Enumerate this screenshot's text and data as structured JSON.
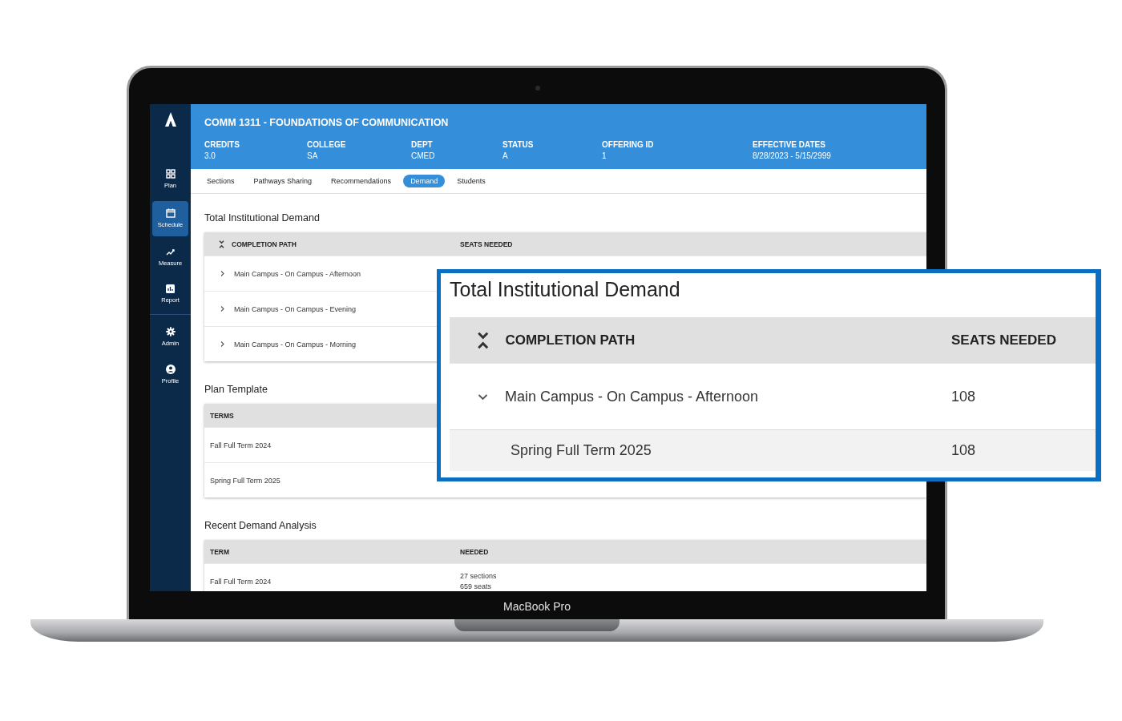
{
  "laptop": {
    "label": "MacBook Pro"
  },
  "sidebar": {
    "items": [
      {
        "label": "Plan",
        "selected": false
      },
      {
        "label": "Schedule",
        "selected": true
      },
      {
        "label": "Measure",
        "selected": false
      },
      {
        "label": "Report",
        "selected": false
      },
      {
        "label": "Admin",
        "selected": false
      },
      {
        "label": "Profile",
        "selected": false
      }
    ]
  },
  "course": {
    "title": "COMM 1311 - FOUNDATIONS OF COMMUNICATION",
    "fields": [
      {
        "label": "CREDITS",
        "value": "3.0"
      },
      {
        "label": "COLLEGE",
        "value": "SA"
      },
      {
        "label": "DEPT",
        "value": "CMED"
      },
      {
        "label": "STATUS",
        "value": "A"
      },
      {
        "label": "OFFERING ID",
        "value": "1"
      },
      {
        "label": "EFFECTIVE DATES",
        "value": "8/28/2023 - 5/15/2999"
      }
    ]
  },
  "tabs": [
    {
      "label": "Sections",
      "selected": false
    },
    {
      "label": "Pathways Sharing",
      "selected": false
    },
    {
      "label": "Recommendations",
      "selected": false
    },
    {
      "label": "Demand",
      "selected": true
    },
    {
      "label": "Students",
      "selected": false
    }
  ],
  "institutional_demand": {
    "title": "Total Institutional Demand",
    "columns": [
      "COMPLETION PATH",
      "SEATS NEEDED"
    ],
    "rows": [
      {
        "path": "Main Campus - On Campus - Afternoon",
        "expanded": false
      },
      {
        "path": "Main Campus - On Campus - Evening",
        "expanded": false
      },
      {
        "path": "Main Campus - On Campus - Morning",
        "expanded": false
      }
    ]
  },
  "plan_template": {
    "title": "Plan Template",
    "columns": [
      "TERMS"
    ],
    "rows": [
      "Fall Full Term 2024",
      "Spring Full Term 2025"
    ]
  },
  "recent_demand": {
    "title": "Recent Demand Analysis",
    "columns": [
      "TERM",
      "NEEDED"
    ],
    "rows": [
      {
        "term": "Fall Full Term 2024",
        "needed": [
          "27 sections",
          "659 seats"
        ]
      }
    ]
  },
  "callout": {
    "title": "Total Institutional Demand",
    "columns": [
      "COMPLETION PATH",
      "SEATS NEEDED"
    ],
    "rows": [
      {
        "path": "Main Campus - On Campus - Afternoon",
        "seats": "108",
        "expanded": true,
        "children": [
          {
            "path": "Spring Full Term 2025",
            "seats": "108"
          }
        ]
      }
    ]
  }
}
